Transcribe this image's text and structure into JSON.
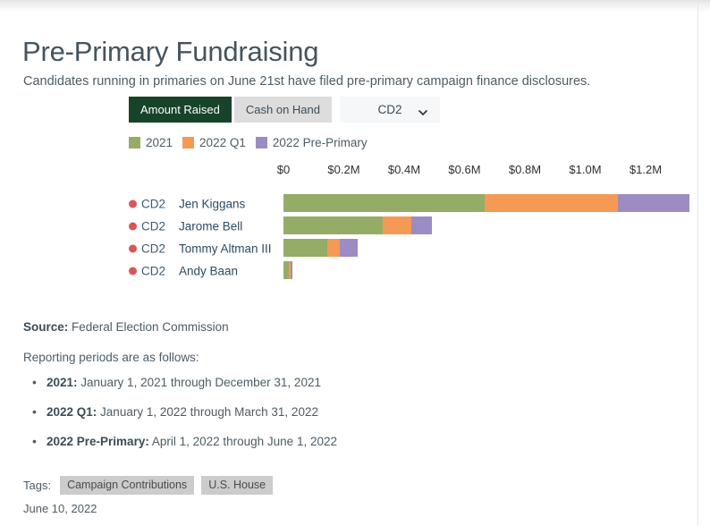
{
  "header": {
    "title": "Pre-Primary Fundraising",
    "subtitle": "Candidates running in primaries on June 21st have filed pre-primary campaign finance disclosures."
  },
  "controls": {
    "toggle_amount_raised": "Amount Raised",
    "toggle_cash_on_hand": "Cash on Hand",
    "district_selected": "CD2",
    "district_options": [
      "CD2"
    ]
  },
  "colors": {
    "green_2021": "#95ac66",
    "orange_2022q1": "#f59a54",
    "purple_prepri": "#9d8cc4",
    "active_button": "#17432b",
    "inactive_button": "#dddddd",
    "party_dot": "#dd5555",
    "tag_chip": "#cccccc"
  },
  "chart_data": {
    "type": "bar",
    "title": "Pre-Primary Fundraising",
    "orientation": "horizontal",
    "stacked": true,
    "xlabel": "",
    "ylabel": "",
    "xlim": [
      0,
      1360000
    ],
    "grid": false,
    "legend_position": "top-left",
    "tick_labels": [
      "$0",
      "$0.2M",
      "$0.4M",
      "$0.6M",
      "$0.8M",
      "$1.0M",
      "$1.2M"
    ],
    "tick_values": [
      0,
      200000,
      400000,
      600000,
      800000,
      1000000,
      1200000
    ],
    "legend": [
      {
        "name": "2021",
        "color": "#95ac66"
      },
      {
        "name": "2022 Q1",
        "color": "#f59a54"
      },
      {
        "name": "2022 Pre-Primary",
        "color": "#9d8cc4"
      }
    ],
    "categories": [
      "Jen Kiggans",
      "Jarome Bell",
      "Tommy Altman III",
      "Andy Baan"
    ],
    "districts": [
      "CD2",
      "CD2",
      "CD2",
      "CD2"
    ],
    "series": [
      {
        "name": "2021",
        "color": "#95ac66",
        "values": [
          666000,
          328000,
          144000,
          18000
        ]
      },
      {
        "name": "2022 Q1",
        "color": "#f59a54",
        "values": [
          442000,
          96000,
          42000,
          4500
        ]
      },
      {
        "name": "2022 Pre-Primary",
        "color": "#9d8cc4",
        "values": [
          238000,
          68000,
          59000,
          7500
        ]
      }
    ]
  },
  "rows": [
    {
      "district": "CD2",
      "name": "Jen Kiggans",
      "v2021": 666000,
      "v2022q1": 442000,
      "vprepri": 238000
    },
    {
      "district": "CD2",
      "name": "Jarome Bell",
      "v2021": 328000,
      "v2022q1": 96000,
      "vprepri": 68000
    },
    {
      "district": "CD2",
      "name": "Tommy Altman III",
      "v2021": 144000,
      "v2022q1": 42000,
      "vprepri": 59000
    },
    {
      "district": "CD2",
      "name": "Andy Baan",
      "v2021": 18000,
      "v2022q1": 4500,
      "vprepri": 7500
    }
  ],
  "footer": {
    "source_label": "Source:",
    "source_value": " Federal Election Commission",
    "periods_intro": "Reporting periods are as follows:",
    "periods": [
      {
        "label": "2021:",
        "text": " January 1, 2021 through December 31, 2021"
      },
      {
        "label": "2022 Q1:",
        "text": " January 1, 2022 through March 31, 2022"
      },
      {
        "label": "2022 Pre-Primary:",
        "text": " April 1, 2022 through June 1, 2022"
      }
    ],
    "tags_label": "Tags:",
    "tags": [
      "Campaign Contributions",
      "U.S. House"
    ],
    "published_date": "June 10, 2022"
  }
}
